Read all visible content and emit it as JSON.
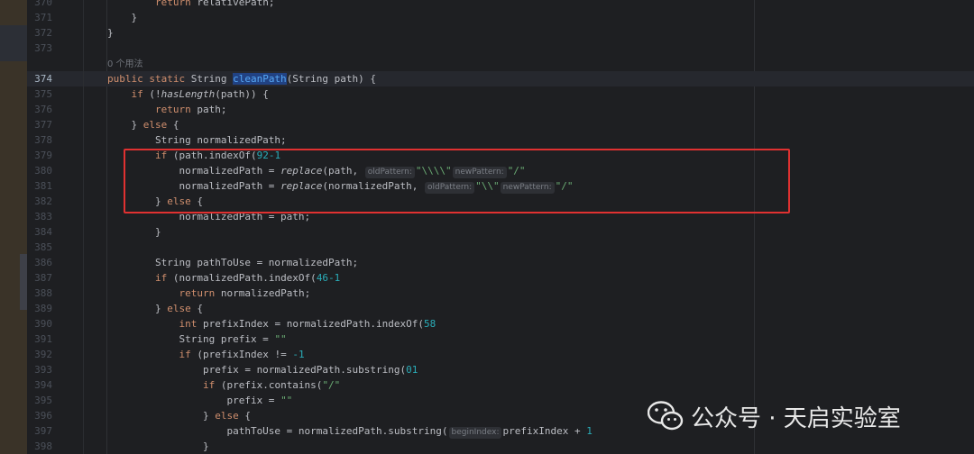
{
  "lines": [
    {
      "n": "370",
      "segs": [
        [
          "",
          "        "
        ],
        [
          "kw",
          "return"
        ],
        [
          "",
          " relativePath;"
        ]
      ]
    },
    {
      "n": "371",
      "segs": [
        [
          "",
          "    }"
        ]
      ]
    },
    {
      "n": "372",
      "segs": [
        [
          "",
          "}"
        ]
      ]
    },
    {
      "n": "373",
      "segs": []
    },
    {
      "n": "",
      "hint": "0 个用法"
    },
    {
      "n": "374",
      "current": true,
      "segs": [
        [
          "kw",
          "public static "
        ],
        [
          "",
          "String "
        ],
        [
          "sel",
          "cleanPath"
        ],
        [
          "",
          "(String path) {"
        ]
      ]
    },
    {
      "n": "375",
      "segs": [
        [
          "",
          "    "
        ],
        [
          "kw",
          "if"
        ],
        [
          "",
          " (!"
        ],
        [
          "it",
          "hasLength"
        ],
        [
          "",
          "(path)) {"
        ]
      ]
    },
    {
      "n": "376",
      "segs": [
        [
          "",
          "        "
        ],
        [
          "kw",
          "return"
        ],
        [
          "",
          " path;"
        ]
      ]
    },
    {
      "n": "377",
      "segs": [
        [
          "",
          "    } "
        ],
        [
          "kw",
          "else"
        ],
        [
          "",
          " {"
        ]
      ]
    },
    {
      "n": "378",
      "segs": [
        [
          "",
          "        String normalizedPath;"
        ]
      ]
    },
    {
      "n": "379",
      "segs": [
        [
          "",
          "        "
        ],
        [
          "kw",
          "if"
        ],
        [
          "",
          " (path.indexOf("
        ],
        [
          "num",
          "92"
        ],
        [
          ") != "
        ],
        [
          "num",
          "-1"
        ],
        [
          ") {"
        ]
      ]
    },
    {
      "n": "380",
      "segs": [
        [
          "",
          "            normalizedPath = "
        ],
        [
          "it",
          "replace"
        ],
        [
          "",
          "(path, "
        ],
        [
          "ph",
          "oldPattern:"
        ],
        [
          "str",
          "\"\\\\\\\\\""
        ],
        [
          ", "
        ],
        [
          "ph",
          "newPattern:"
        ],
        [
          "str",
          "\"/\""
        ],
        [
          ");"
        ]
      ]
    },
    {
      "n": "381",
      "segs": [
        [
          "",
          "            normalizedPath = "
        ],
        [
          "it",
          "replace"
        ],
        [
          "",
          "(normalizedPath, "
        ],
        [
          "ph",
          "oldPattern:"
        ],
        [
          "str",
          "\"\\\\\""
        ],
        [
          ", "
        ],
        [
          "ph",
          "newPattern:"
        ],
        [
          "str",
          "\"/\""
        ],
        [
          ");"
        ]
      ]
    },
    {
      "n": "382",
      "segs": [
        [
          "",
          "        } "
        ],
        [
          "kw",
          "else"
        ],
        [
          "",
          " {"
        ]
      ]
    },
    {
      "n": "383",
      "segs": [
        [
          "",
          "            normalizedPath = path;"
        ]
      ]
    },
    {
      "n": "384",
      "segs": [
        [
          "",
          "        }"
        ]
      ]
    },
    {
      "n": "385",
      "segs": []
    },
    {
      "n": "386",
      "segs": [
        [
          "",
          "        String pathToUse = normalizedPath;"
        ]
      ]
    },
    {
      "n": "387",
      "segs": [
        [
          "",
          "        "
        ],
        [
          "kw",
          "if"
        ],
        [
          "",
          " (normalizedPath.indexOf("
        ],
        [
          "num",
          "46"
        ],
        [
          ") == "
        ],
        [
          "num",
          "-1"
        ],
        [
          ") {"
        ]
      ]
    },
    {
      "n": "388",
      "segs": [
        [
          "",
          "            "
        ],
        [
          "kw",
          "return"
        ],
        [
          "",
          " normalizedPath;"
        ]
      ]
    },
    {
      "n": "389",
      "segs": [
        [
          "",
          "        } "
        ],
        [
          "kw",
          "else"
        ],
        [
          "",
          " {"
        ]
      ]
    },
    {
      "n": "390",
      "segs": [
        [
          "",
          "            "
        ],
        [
          "kw",
          "int"
        ],
        [
          "",
          " prefixIndex = normalizedPath.indexOf("
        ],
        [
          "num",
          "58"
        ],
        [
          ");"
        ]
      ]
    },
    {
      "n": "391",
      "segs": [
        [
          "",
          "            String prefix = "
        ],
        [
          "str",
          "\"\""
        ],
        [
          ";"
        ]
      ]
    },
    {
      "n": "392",
      "segs": [
        [
          "",
          "            "
        ],
        [
          "kw",
          "if"
        ],
        [
          "",
          " (prefixIndex != "
        ],
        [
          "num",
          "-1"
        ],
        [
          ") {"
        ]
      ]
    },
    {
      "n": "393",
      "segs": [
        [
          "",
          "                prefix = normalizedPath.substring("
        ],
        [
          "num",
          "0"
        ],
        [
          ", prefixIndex + "
        ],
        [
          "num",
          "1"
        ],
        [
          ");"
        ]
      ]
    },
    {
      "n": "394",
      "segs": [
        [
          "",
          "                "
        ],
        [
          "kw",
          "if"
        ],
        [
          "",
          " (prefix.contains("
        ],
        [
          "str",
          "\"/\""
        ],
        [
          ")) {"
        ]
      ]
    },
    {
      "n": "395",
      "segs": [
        [
          "",
          "                    prefix = "
        ],
        [
          "str",
          "\"\""
        ],
        [
          ";"
        ]
      ]
    },
    {
      "n": "396",
      "segs": [
        [
          "",
          "                } "
        ],
        [
          "kw",
          "else"
        ],
        [
          "",
          " {"
        ]
      ]
    },
    {
      "n": "397",
      "segs": [
        [
          "",
          "                    pathToUse = normalizedPath.substring("
        ],
        [
          "ph",
          "beginIndex:"
        ],
        [
          "",
          "prefixIndex + "
        ],
        [
          "num",
          "1"
        ],
        [
          ");"
        ]
      ]
    },
    {
      "n": "398",
      "segs": [
        [
          "",
          "                }"
        ]
      ]
    }
  ],
  "watermark": {
    "text": "公众号 · 天启实验室",
    "icon": "wechat-icon"
  },
  "colors": {
    "background": "#1e1f22",
    "keyword": "#cf8e6d",
    "string": "#6aab73",
    "number": "#2aacb8",
    "highlight_box": "#e03131"
  }
}
